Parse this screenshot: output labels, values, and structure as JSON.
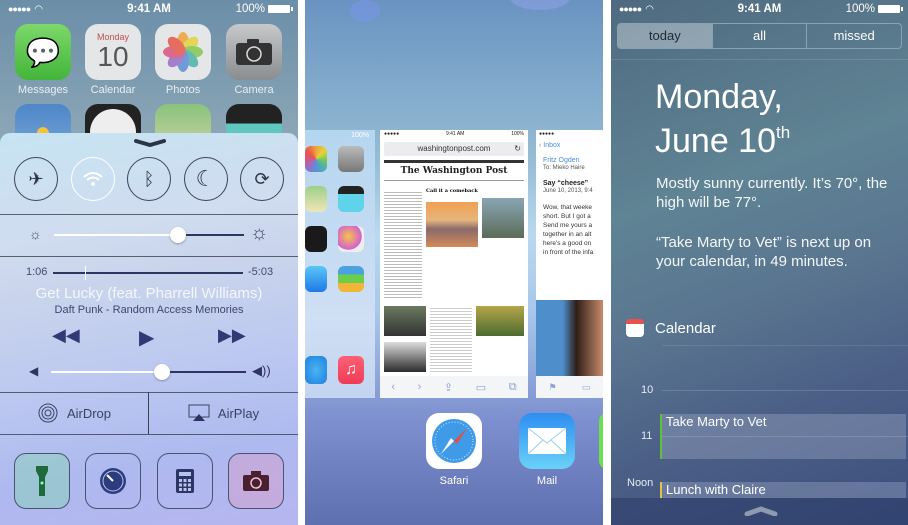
{
  "status_bar": {
    "signal": "●●●●●",
    "time": "9:41 AM",
    "battery": "100%"
  },
  "control_center": {
    "home_apps": [
      {
        "label": "Messages",
        "icon": "messages-icon"
      },
      {
        "label": "Calendar",
        "icon": "calendar-icon",
        "day": "Monday",
        "date": "10"
      },
      {
        "label": "Photos",
        "icon": "photos-icon"
      },
      {
        "label": "Camera",
        "icon": "camera-icon"
      }
    ],
    "toggles": [
      {
        "name": "airplane-mode",
        "glyph": "✈",
        "on": false
      },
      {
        "name": "wifi",
        "glyph": "wifi",
        "on": true
      },
      {
        "name": "bluetooth",
        "glyph": "ᛒ",
        "on": false
      },
      {
        "name": "do-not-disturb",
        "glyph": "☾",
        "on": false
      },
      {
        "name": "rotation-lock",
        "glyph": "⟳",
        "on": false
      }
    ],
    "brightness": 0.65,
    "music": {
      "elapsed": "1:06",
      "remaining": "-5:03",
      "progress": 0.17,
      "title": "Get Lucky (feat. Pharrell Williams)",
      "artist_album": "Daft Punk - Random Access Memories"
    },
    "volume": 0.57,
    "airdrop_label": "AirDrop",
    "airplay_label": "AirPlay",
    "tools": [
      "flashlight",
      "timer",
      "calculator",
      "camera"
    ]
  },
  "multitasking": {
    "home_labels": [
      "Photos",
      "Camera",
      "Maps",
      "Videos",
      "Stocks",
      "Game Center",
      "App Store",
      "Passbook",
      "Safari",
      "Music"
    ],
    "safari_card": {
      "time": "9:41 AM",
      "battery": "100%",
      "url": "washingtonpost.com",
      "masthead": "The Washington Post",
      "headline": "Call it a comeback"
    },
    "mail_card": {
      "back": "Inbox",
      "from": "Fritz Ogden",
      "to": "To: Mieko Haire",
      "subject": "Say “cheese”",
      "date": "June 10, 2013, 9:4",
      "body": "Wow, that weeke short. But I got a Send me yours a together in an alt here's a good on in front of the infa"
    },
    "dock": [
      {
        "label": "Safari"
      },
      {
        "label": "Mail"
      }
    ]
  },
  "notification_center": {
    "tabs": [
      {
        "label": "today",
        "active": true
      },
      {
        "label": "all",
        "active": false
      },
      {
        "label": "missed",
        "active": false
      }
    ],
    "date_line1": "Monday,",
    "date_line2": "June 10",
    "date_suffix": "th",
    "weather": "Mostly sunny currently. It’s 70°, the high will be 77°.",
    "next_up": "“Take Marty to Vet” is next up on your calendar, in 49 minutes.",
    "calendar_title": "Calendar",
    "hours": [
      "10",
      "11",
      "Noon"
    ],
    "events": [
      {
        "title": "Take Marty to Vet",
        "color": "#5fc13a"
      },
      {
        "title": "Lunch with Claire",
        "color": "#e6c43a"
      }
    ]
  }
}
